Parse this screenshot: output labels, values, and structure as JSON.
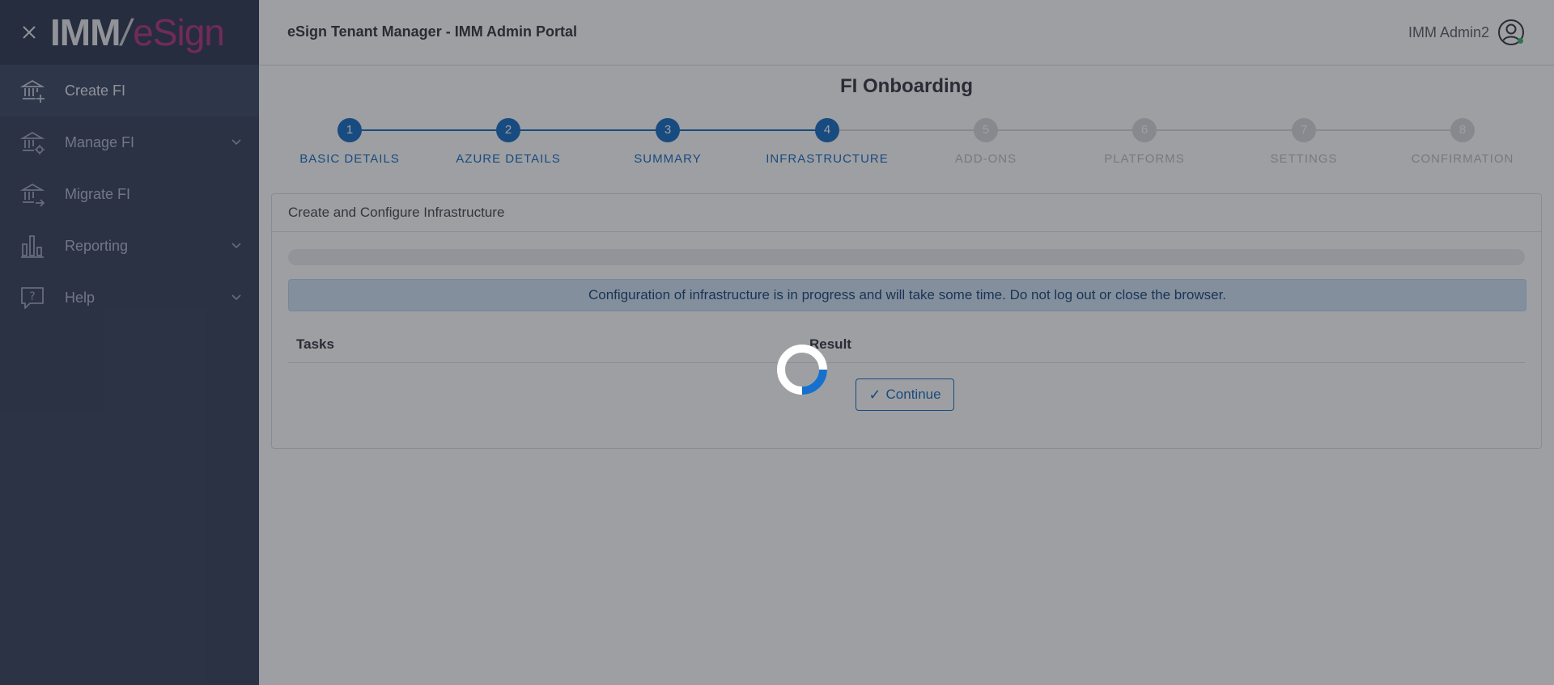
{
  "sidebar": {
    "logo": {
      "part1": "IMM",
      "part2": "eSign"
    },
    "items": [
      {
        "label": "Create FI",
        "icon": "bank-add-icon",
        "active": true,
        "has_submenu": false
      },
      {
        "label": "Manage FI",
        "icon": "bank-gear-icon",
        "active": false,
        "has_submenu": true
      },
      {
        "label": "Migrate FI",
        "icon": "bank-arrow-icon",
        "active": false,
        "has_submenu": false
      },
      {
        "label": "Reporting",
        "icon": "bar-chart-icon",
        "active": false,
        "has_submenu": true
      },
      {
        "label": "Help",
        "icon": "help-chat-icon",
        "active": false,
        "has_submenu": true
      }
    ]
  },
  "header": {
    "title": "eSign Tenant Manager - IMM Admin Portal",
    "user_name": "IMM Admin2"
  },
  "page": {
    "title": "FI Onboarding",
    "steps": [
      {
        "number": "1",
        "label": "BASIC DETAILS",
        "state": "done"
      },
      {
        "number": "2",
        "label": "AZURE DETAILS",
        "state": "done"
      },
      {
        "number": "3",
        "label": "SUMMARY",
        "state": "done"
      },
      {
        "number": "4",
        "label": "INFRASTRUCTURE",
        "state": "done"
      },
      {
        "number": "5",
        "label": "ADD-ONS",
        "state": "todo"
      },
      {
        "number": "6",
        "label": "PLATFORMS",
        "state": "todo"
      },
      {
        "number": "7",
        "label": "SETTINGS",
        "state": "todo"
      },
      {
        "number": "8",
        "label": "CONFIRMATION",
        "state": "todo"
      }
    ],
    "card": {
      "title": "Create and Configure Infrastructure",
      "progress": 0,
      "alert": "Configuration of infrastructure is in progress and will take some time. Do not log out or close the browser.",
      "table": {
        "col_tasks": "Tasks",
        "col_result": "Result"
      },
      "continue_label": "Continue"
    }
  },
  "colors": {
    "sidebar_bg": "#2f3a55",
    "accent": "#0b66c2",
    "brand_magenta": "#b02a7c",
    "step_inactive": "#d6d7db"
  },
  "loading": true
}
